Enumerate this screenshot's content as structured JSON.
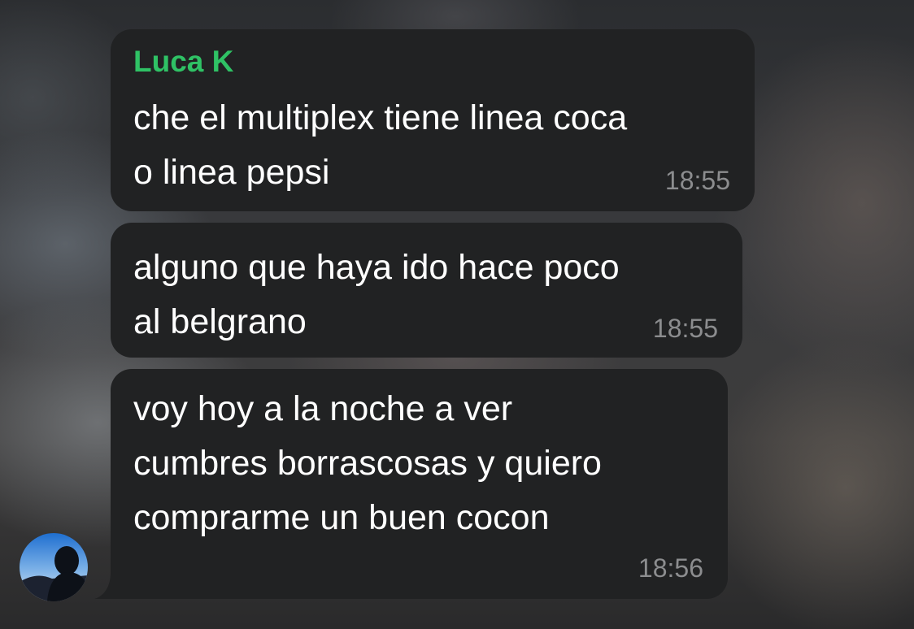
{
  "chat": {
    "messages": [
      {
        "sender": "Luca K",
        "text": "che el multiplex tiene linea coca\no linea pepsi",
        "time": "18:55"
      },
      {
        "text": "alguno que haya ido hace poco\nal belgrano",
        "time": "18:55"
      },
      {
        "text": "voy hoy a la noche a ver\ncumbres borrascosas y quiero\ncomprarme un buen cocon",
        "time": "18:56"
      }
    ]
  },
  "colors": {
    "sender_name": "#2fc265",
    "bubble_bg": "#212223",
    "timestamp": "#8c8d8f",
    "message_text": "#ffffff"
  }
}
